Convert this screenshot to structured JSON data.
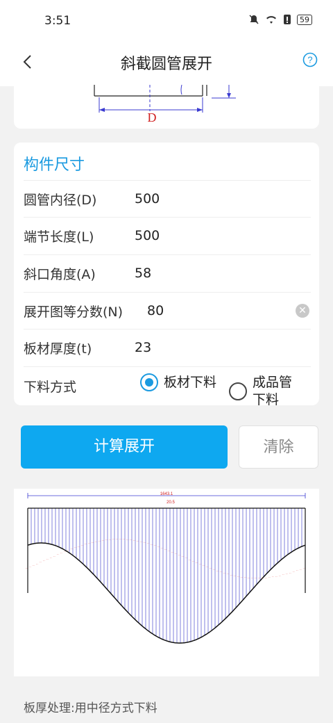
{
  "status": {
    "time": "3:51",
    "battery": "59"
  },
  "header": {
    "title": "斜截圆管展开"
  },
  "diagram": {
    "dim_label": "D"
  },
  "form": {
    "section_title": "构件尺寸",
    "fields": [
      {
        "label": "圆管内径(D)",
        "value": "500"
      },
      {
        "label": "端节长度(L)",
        "value": "500"
      },
      {
        "label": "斜口角度(A)",
        "value": "58"
      },
      {
        "label": "展开图等分数(N)",
        "value": "80"
      },
      {
        "label": "板材厚度(t)",
        "value": "23"
      }
    ],
    "material_label": "下料方式",
    "options": [
      {
        "label": "板材下料",
        "selected": true
      },
      {
        "label": "成品管下料",
        "selected": false
      }
    ]
  },
  "buttons": {
    "calculate": "计算展开",
    "clear": "清除"
  },
  "result": {
    "total_length": "1643.1",
    "segment_length": "20.5"
  },
  "footnote": "板厚处理:用中径方式下料",
  "colors": {
    "accent": "#0ea8f0",
    "section": "#1a9ae0",
    "hatch": "#4a4ad0",
    "dims": "#d02020"
  }
}
